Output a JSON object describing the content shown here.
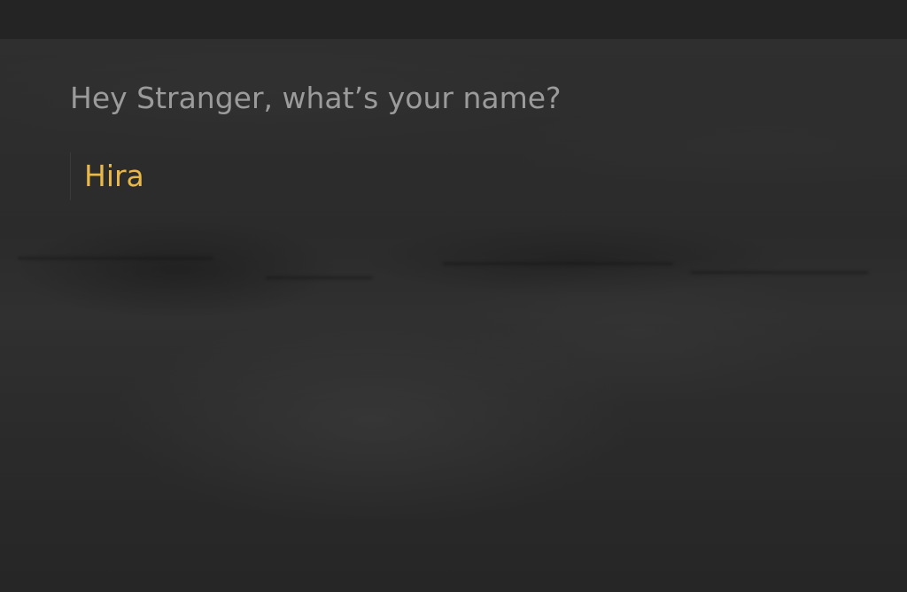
{
  "prompt": {
    "text": "Hey Stranger, what’s your name?"
  },
  "name_input": {
    "value": "Hira",
    "text_color": "#e8b84a"
  },
  "colors": {
    "status_bar": "#242424",
    "prompt_text": "#9b9b9b",
    "background": "#262626"
  }
}
